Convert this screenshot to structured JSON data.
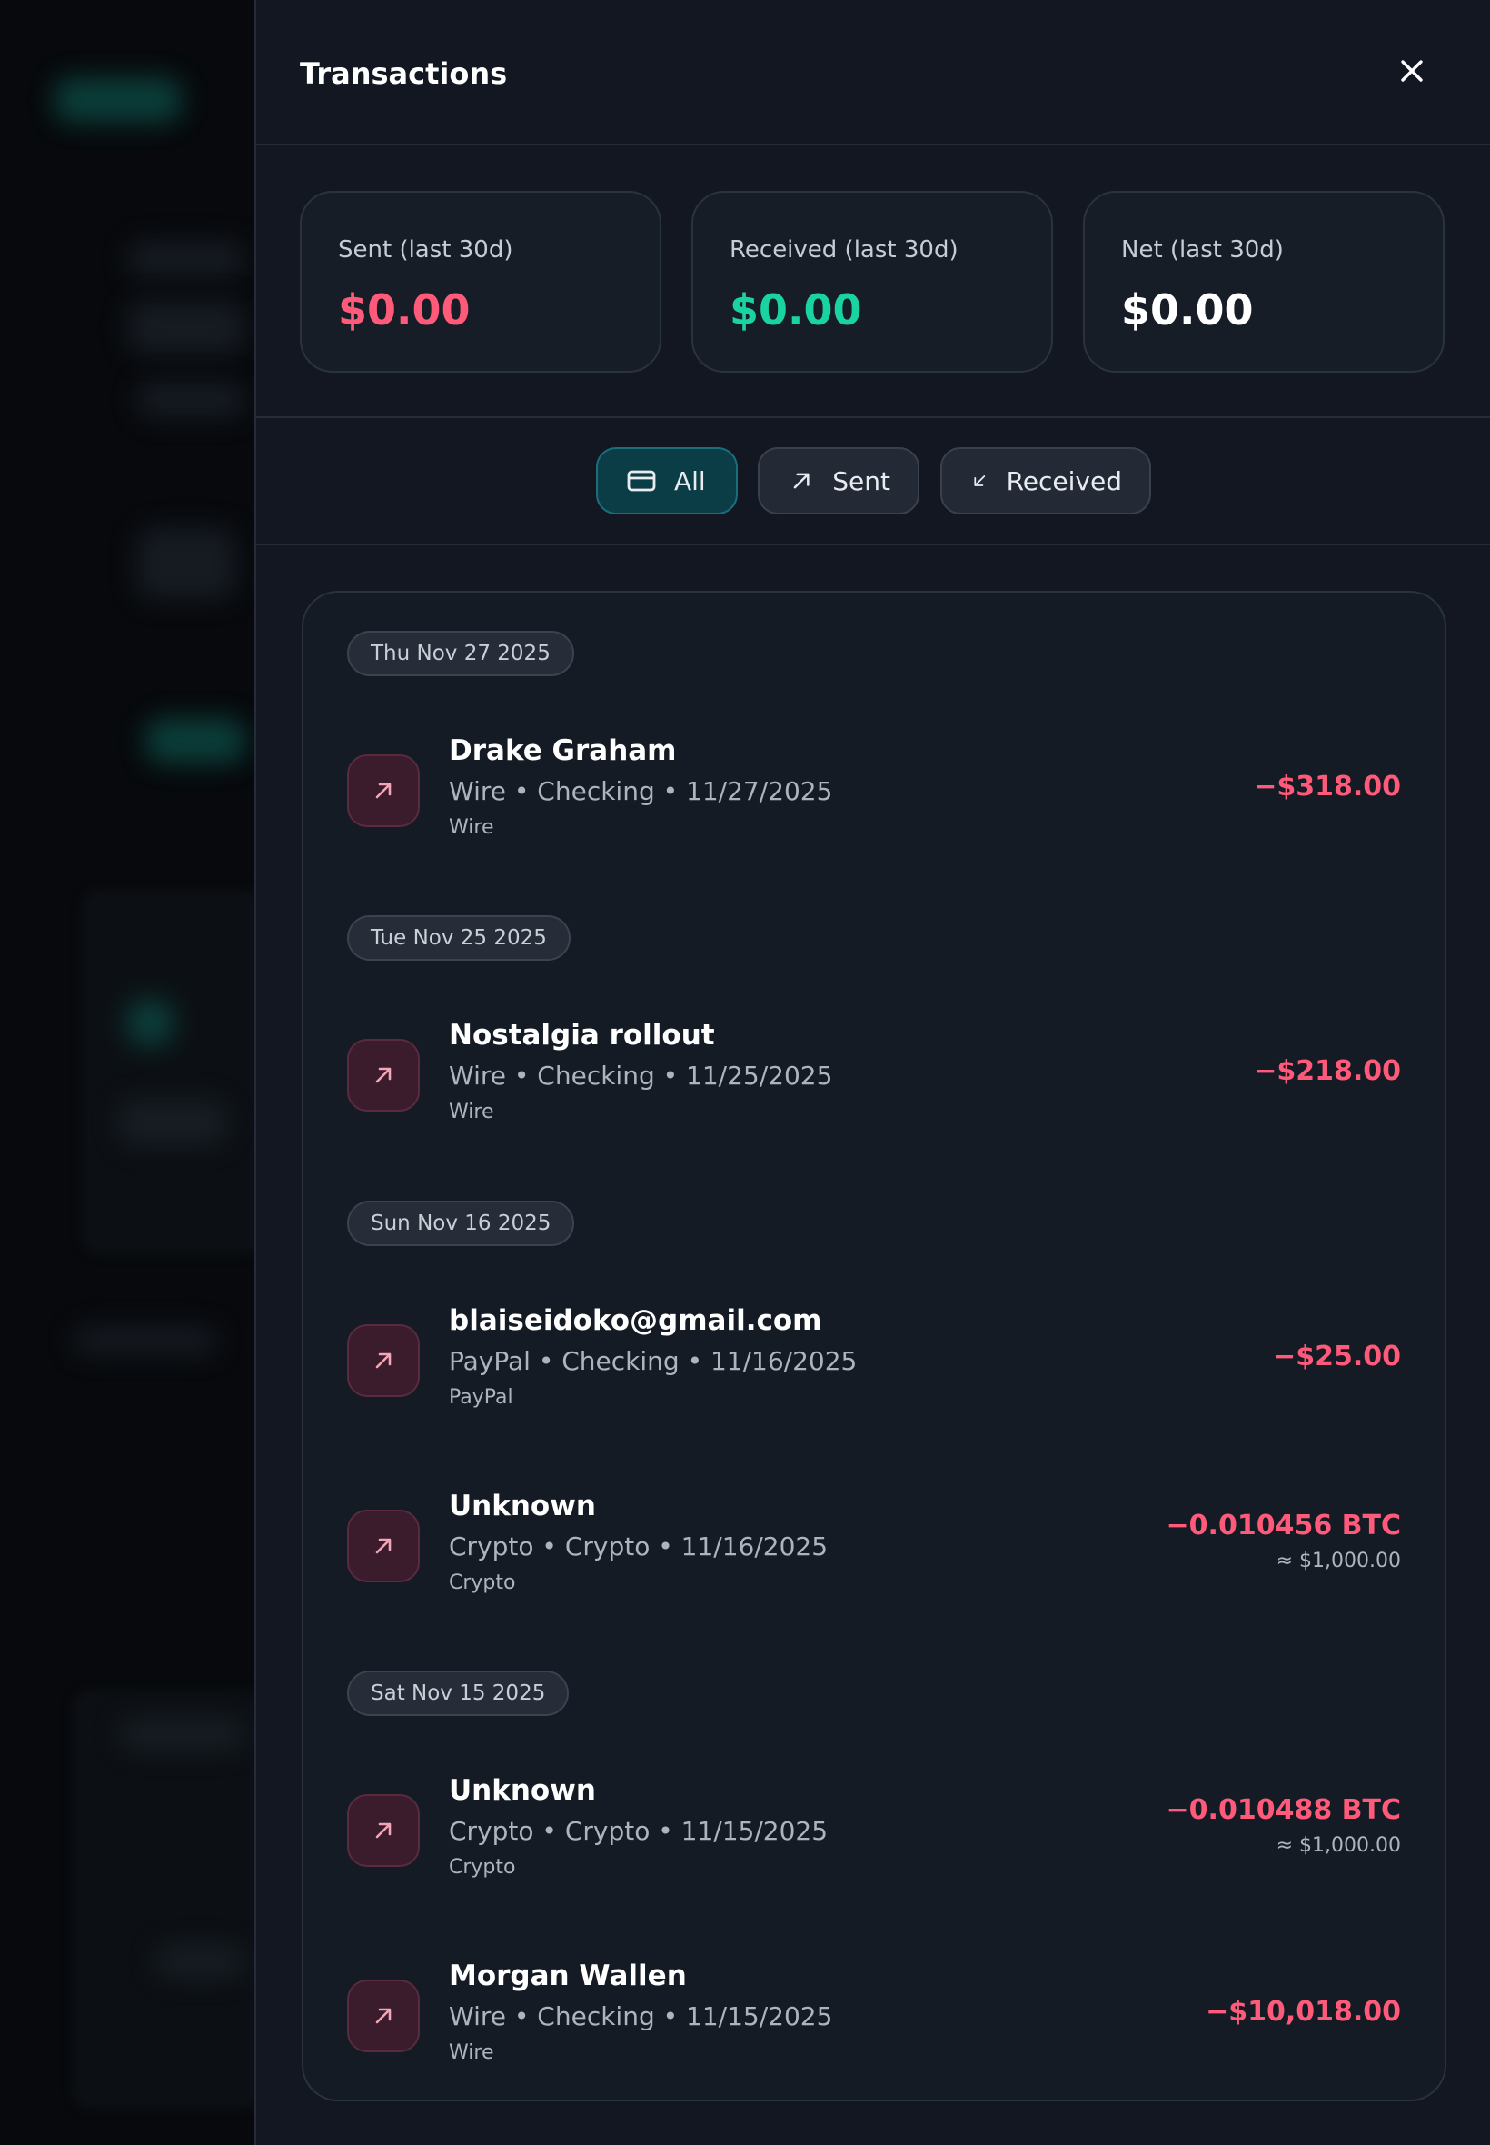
{
  "panel": {
    "title": "Transactions",
    "close_icon": "close-icon"
  },
  "stats": [
    {
      "label": "Sent (last 30d)",
      "value": "$0.00",
      "color": "#ff5a7a"
    },
    {
      "label": "Received (last 30d)",
      "value": "$0.00",
      "color": "#19d3a1"
    },
    {
      "label": "Net (last 30d)",
      "value": "$0.00",
      "color": "#ffffff"
    }
  ],
  "filters": [
    {
      "label": "All",
      "icon": "card-icon",
      "active": true
    },
    {
      "label": "Sent",
      "icon": "arrow-up-right-icon",
      "active": false
    },
    {
      "label": "Received",
      "icon": "arrow-down-left-icon",
      "active": false
    }
  ],
  "groups": [
    {
      "date": "Thu Nov 27 2025",
      "items": [
        {
          "name": "Drake Graham",
          "meta": "Wire • Checking • 11/27/2025",
          "method": "Wire",
          "amount": "−$318.00"
        }
      ]
    },
    {
      "date": "Tue Nov 25 2025",
      "items": [
        {
          "name": "Nostalgia rollout",
          "meta": "Wire • Checking • 11/25/2025",
          "method": "Wire",
          "amount": "−$218.00"
        }
      ]
    },
    {
      "date": "Sun Nov 16 2025",
      "items": [
        {
          "name": "blaiseidoko@gmail.com",
          "meta": "PayPal • Checking • 11/16/2025",
          "method": "PayPal",
          "amount": "−$25.00"
        },
        {
          "name": "Unknown",
          "meta": "Crypto • Crypto • 11/16/2025",
          "method": "Crypto",
          "amount": "−0.010456 BTC",
          "approx": "≈ $1,000.00"
        }
      ]
    },
    {
      "date": "Sat Nov 15 2025",
      "items": [
        {
          "name": "Unknown",
          "meta": "Crypto • Crypto • 11/15/2025",
          "method": "Crypto",
          "amount": "−0.010488 BTC",
          "approx": "≈ $1,000.00"
        },
        {
          "name": "Morgan Wallen",
          "meta": "Wire • Checking • 11/15/2025",
          "method": "Wire",
          "amount": "−$10,018.00"
        }
      ]
    }
  ],
  "colors": {
    "sent": "#ff5a7a",
    "received": "#19d3a1",
    "accent_active": "#0b3d47"
  }
}
